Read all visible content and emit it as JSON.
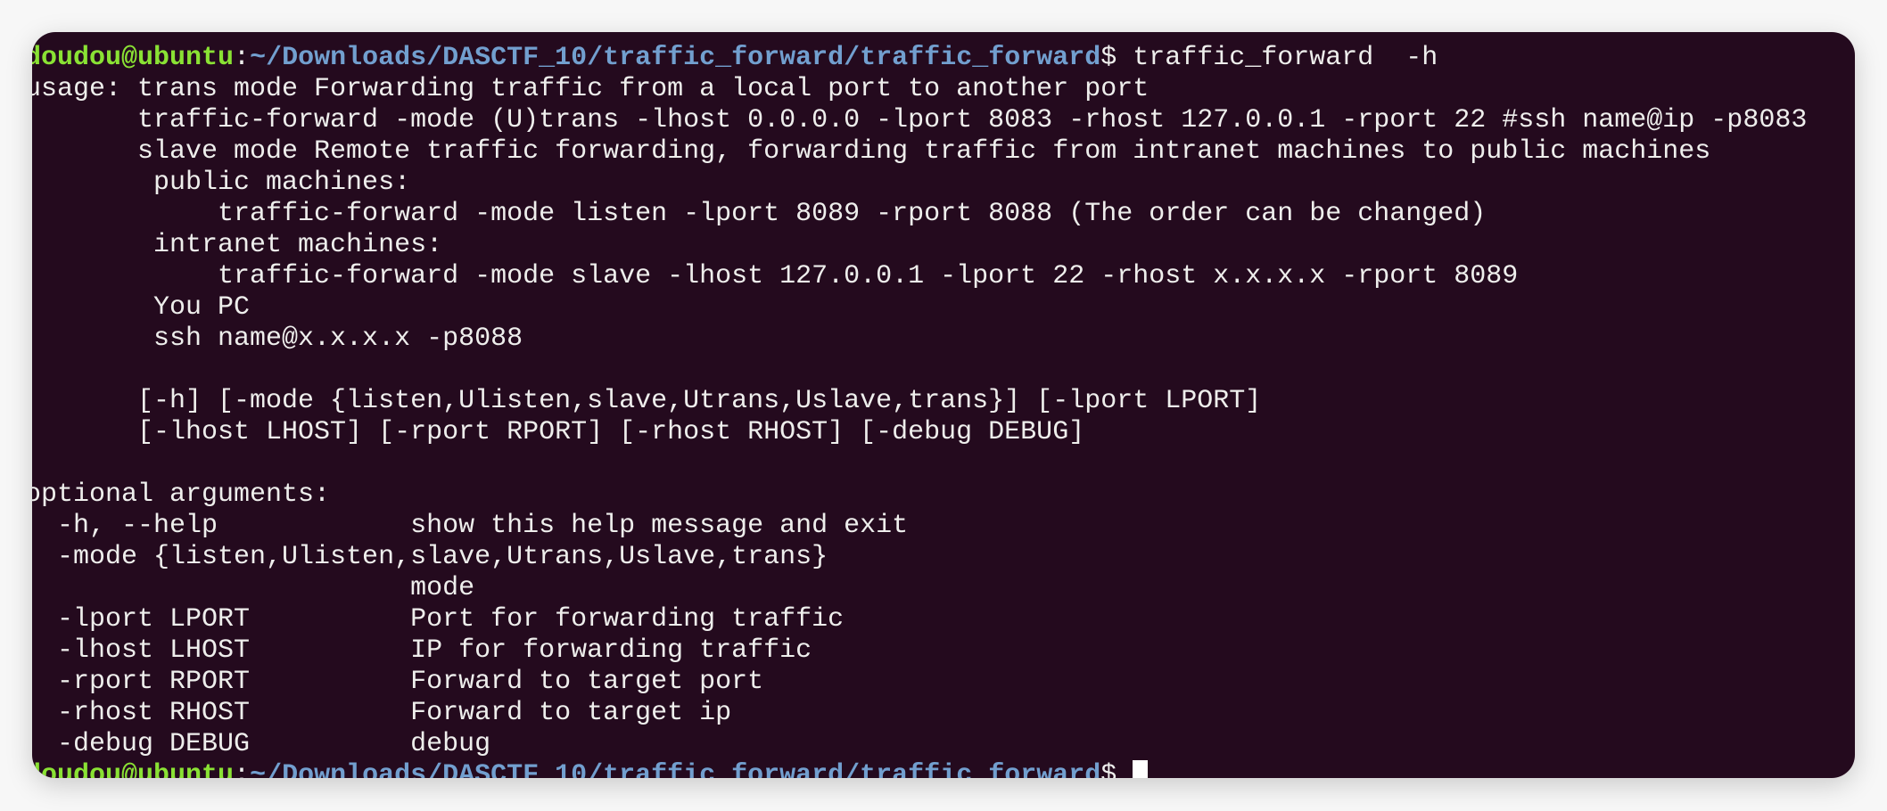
{
  "prompt": {
    "user_host": "doudou@ubuntu",
    "sep": ":",
    "path": "~/Downloads/DASCTF_10/traffic_forward/traffic_forward",
    "symbol": "$ ",
    "command": "traffic_forward  -h"
  },
  "output_lines": [
    "usage: trans mode Forwarding traffic from a local port to another port",
    "       traffic-forward -mode (U)trans -lhost 0.0.0.0 -lport 8083 -rhost 127.0.0.1 -rport 22 #ssh name@ip -p8083",
    "       slave mode Remote traffic forwarding, forwarding traffic from intranet machines to public machines",
    "        public machines:",
    "            traffic-forward -mode listen -lport 8089 -rport 8088 (The order can be changed)",
    "        intranet machines:",
    "            traffic-forward -mode slave -lhost 127.0.0.1 -lport 22 -rhost x.x.x.x -rport 8089",
    "        You PC",
    "        ssh name@x.x.x.x -p8088",
    "",
    "       [-h] [-mode {listen,Ulisten,slave,Utrans,Uslave,trans}] [-lport LPORT]",
    "       [-lhost LHOST] [-rport RPORT] [-rhost RHOST] [-debug DEBUG]",
    "",
    "optional arguments:",
    "  -h, --help            show this help message and exit",
    "  -mode {listen,Ulisten,slave,Utrans,Uslave,trans}",
    "                        mode",
    "  -lport LPORT          Port for forwarding traffic",
    "  -lhost LHOST          IP for forwarding traffic",
    "  -rport RPORT          Forward to target port",
    "  -rhost RHOST          Forward to target ip",
    "  -debug DEBUG          debug"
  ],
  "colors": {
    "background": "#240a1e",
    "user": "#8ae234",
    "path": "#729fcf",
    "text": "#eeeeec"
  }
}
